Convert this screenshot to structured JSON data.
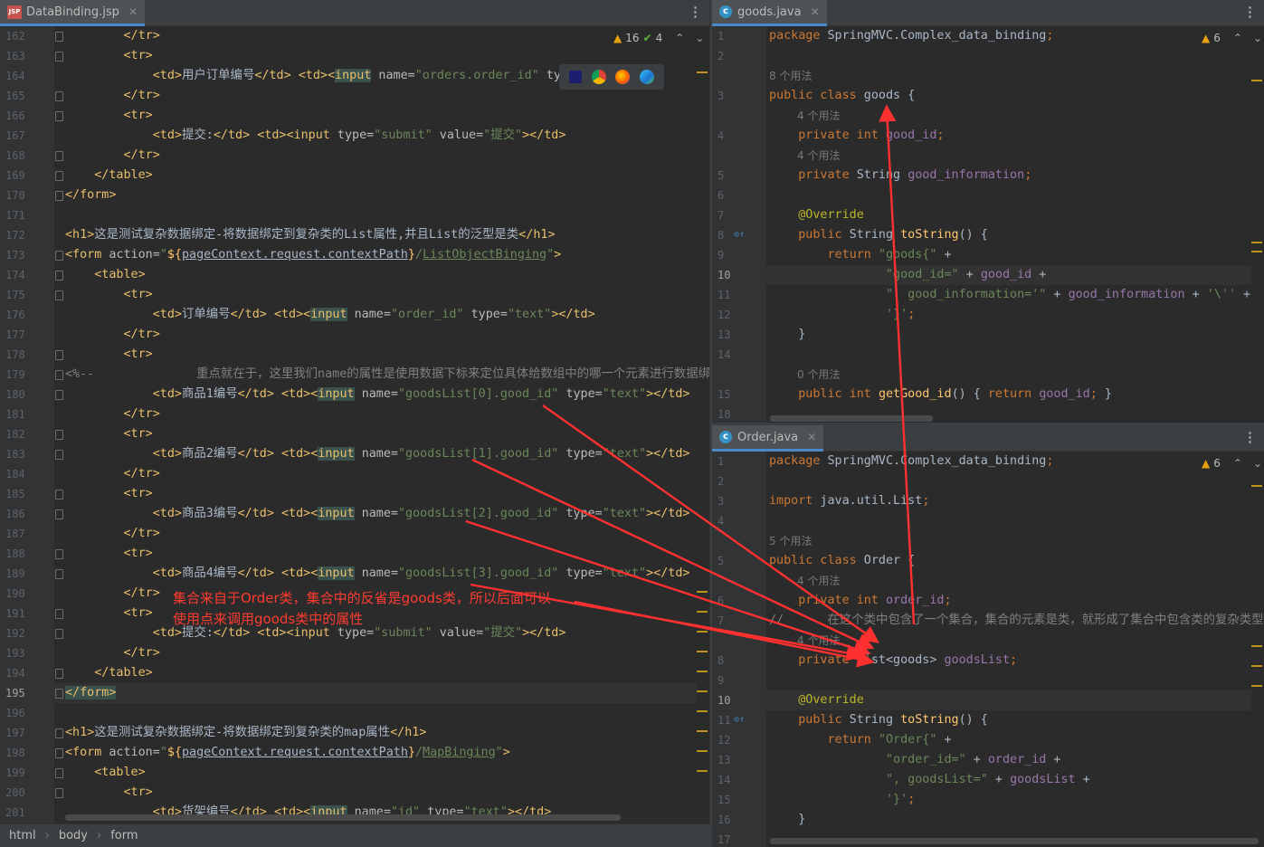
{
  "tabs": {
    "left": {
      "label": "DataBinding.jsp",
      "icon": "jsp-file-icon"
    },
    "right_top": {
      "label": "goods.java",
      "icon": "java-class-icon"
    },
    "right_bottom": {
      "label": "Order.java",
      "icon": "java-class-icon"
    }
  },
  "left_inspections": {
    "warnings": "16",
    "checks": "4"
  },
  "right_top_inspections": {
    "warnings": "6"
  },
  "right_bottom_inspections": {
    "warnings": "6"
  },
  "left_lines": [
    {
      "n": "162",
      "h": "        <span class=tg>&lt;/tr&gt;</span>"
    },
    {
      "n": "163",
      "h": "        <span class=tg>&lt;tr&gt;</span>"
    },
    {
      "n": "164",
      "h": "            <span class=tg>&lt;td&gt;</span>用户订单编号<span class=tg>&lt;/td&gt;</span> <span class=tg>&lt;td&gt;&lt;<span class=hl>input</span></span> <span class=at>name=</span><span class=sv>\"orders.order_id\"</span> <span class=at>typ</span>"
    },
    {
      "n": "165",
      "h": "        <span class=tg>&lt;/tr&gt;</span>"
    },
    {
      "n": "166",
      "h": "        <span class=tg>&lt;tr&gt;</span>"
    },
    {
      "n": "167",
      "h": "            <span class=tg>&lt;td&gt;</span>提交:<span class=tg>&lt;/td&gt;</span> <span class=tg>&lt;td&gt;&lt;input</span> <span class=at>type=</span><span class=sv>\"submit\"</span> <span class=at>value=</span><span class=sv>\"提交\"</span><span class=tg>&gt;&lt;/td&gt;</span>"
    },
    {
      "n": "168",
      "h": "        <span class=tg>&lt;/tr&gt;</span>"
    },
    {
      "n": "169",
      "h": "    <span class=tg>&lt;/table&gt;</span>"
    },
    {
      "n": "170",
      "h": "<span class=tg>&lt;/form&gt;</span>"
    },
    {
      "n": "171",
      "h": ""
    },
    {
      "n": "172",
      "h": "<span class=tg>&lt;h1&gt;</span>这是测试复杂数据绑定-将数据绑定到复杂类的List属性,并且List的泛型是类<span class=tg>&lt;/h1&gt;</span>"
    },
    {
      "n": "173",
      "h": "<span class=tg>&lt;form</span> <span class=at>action=</span><span class=sv>\"</span><span class=mt>${</span><span class=el>pageContext.request.contextPath</span><span class=mt>}</span><span class=sv>/<u>ListObjectBinging</u>\"</span><span class=tg>&gt;</span>"
    },
    {
      "n": "174",
      "h": "    <span class=tg>&lt;table&gt;</span>"
    },
    {
      "n": "175",
      "h": "        <span class=tg>&lt;tr&gt;</span>"
    },
    {
      "n": "176",
      "h": "            <span class=tg>&lt;td&gt;</span>订单编号<span class=tg>&lt;/td&gt;</span> <span class=tg>&lt;td&gt;&lt;<span class=hl>input</span></span> <span class=at>name=</span><span class=sv>\"order_id\"</span> <span class=at>type=</span><span class=sv>\"text\"</span><span class=tg>&gt;&lt;/td&gt;</span>"
    },
    {
      "n": "177",
      "h": "        <span class=tg>&lt;/tr&gt;</span>"
    },
    {
      "n": "178",
      "h": "        <span class=tg>&lt;tr&gt;</span>"
    },
    {
      "n": "179",
      "h": "<span class=cm>&lt;%--              重点就在于，这里我们name的属性是使用数据下标来定位具体给数组中的哪一个元素进行数据绑定--%</span>"
    },
    {
      "n": "180",
      "h": "            <span class=tg>&lt;td&gt;</span>商品1编号<span class=tg>&lt;/td&gt;</span> <span class=tg>&lt;td&gt;&lt;<span class=hl>input</span></span> <span class=at>name=</span><span class=sv>\"goodsList[0].good_id\"</span> <span class=at>type=</span><span class=sv>\"text\"</span><span class=tg>&gt;&lt;/td&gt;</span>"
    },
    {
      "n": "181",
      "h": "        <span class=tg>&lt;/tr&gt;</span>"
    },
    {
      "n": "182",
      "h": "        <span class=tg>&lt;tr&gt;</span>"
    },
    {
      "n": "183",
      "h": "            <span class=tg>&lt;td&gt;</span>商品2编号<span class=tg>&lt;/td&gt;</span> <span class=tg>&lt;td&gt;&lt;<span class=hl>input</span></span> <span class=at>name=</span><span class=sv>\"goodsList[1].good_id\"</span> <span class=at>type=</span><span class=sv>\"text\"</span><span class=tg>&gt;&lt;/td&gt;</span>"
    },
    {
      "n": "184",
      "h": "        <span class=tg>&lt;/tr&gt;</span>"
    },
    {
      "n": "185",
      "h": "        <span class=tg>&lt;tr&gt;</span>"
    },
    {
      "n": "186",
      "h": "            <span class=tg>&lt;td&gt;</span>商品3编号<span class=tg>&lt;/td&gt;</span> <span class=tg>&lt;td&gt;&lt;<span class=hl>input</span></span> <span class=at>name=</span><span class=sv>\"goodsList[2].good_id\"</span> <span class=at>type=</span><span class=sv>\"text\"</span><span class=tg>&gt;&lt;/td&gt;</span>"
    },
    {
      "n": "187",
      "h": "        <span class=tg>&lt;/tr&gt;</span>"
    },
    {
      "n": "188",
      "h": "        <span class=tg>&lt;tr&gt;</span>"
    },
    {
      "n": "189",
      "h": "            <span class=tg>&lt;td&gt;</span>商品4编号<span class=tg>&lt;/td&gt;</span> <span class=tg>&lt;td&gt;&lt;<span class=hl>input</span></span> <span class=at>name=</span><span class=sv>\"goodsList[3].good_id\"</span> <span class=at>type=</span><span class=sv>\"text\"</span><span class=tg>&gt;&lt;/td&gt;</span>"
    },
    {
      "n": "190",
      "h": "        <span class=tg>&lt;/tr&gt;</span>"
    },
    {
      "n": "191",
      "h": "        <span class=tg>&lt;tr&gt;</span>"
    },
    {
      "n": "192",
      "h": "            <span class=tg>&lt;td&gt;</span>提交:<span class=tg>&lt;/td&gt;</span> <span class=tg>&lt;td&gt;&lt;input</span> <span class=at>type=</span><span class=sv>\"submit\"</span> <span class=at>value=</span><span class=sv>\"提交\"</span><span class=tg>&gt;&lt;/td&gt;</span>"
    },
    {
      "n": "193",
      "h": "        <span class=tg>&lt;/tr&gt;</span>"
    },
    {
      "n": "194",
      "h": "    <span class=tg>&lt;/table&gt;</span>"
    },
    {
      "n": "195",
      "h": "<span class=tg style='background:#3b514d'>&lt;/form&gt;</span>"
    },
    {
      "n": "196",
      "h": ""
    },
    {
      "n": "197",
      "h": "<span class=tg>&lt;h1&gt;</span>这是测试复杂数据绑定-将数据绑定到复杂类的map属性<span class=tg>&lt;/h1&gt;</span>"
    },
    {
      "n": "198",
      "h": "<span class=tg>&lt;form</span> <span class=at>action=</span><span class=sv>\"</span><span class=mt>${</span><span class=el>pageContext.request.contextPath</span><span class=mt>}</span><span class=sv>/<u>MapBinging</u>\"</span><span class=tg>&gt;</span>"
    },
    {
      "n": "199",
      "h": "    <span class=tg>&lt;table&gt;</span>"
    },
    {
      "n": "200",
      "h": "        <span class=tg>&lt;tr&gt;</span>"
    },
    {
      "n": "201",
      "h": "            <span class=tg>&lt;td&gt;</span>货架编号<span class=tg>&lt;/td&gt;</span> <span class=tg>&lt;td&gt;&lt;<span class=hl>input</span></span> <span class=at>name=</span><span class=sv>\"id\"</span> <span class=at>type=</span><span class=sv>\"text\"</span><span class=tg>&gt;&lt;/td&gt;</span>"
    }
  ],
  "left_current_line": "195",
  "goods_lines": [
    {
      "n": "1",
      "h": "<span class=kw>package</span> SpringMVC.Complex_data_binding<span class=kw>;</span>"
    },
    {
      "n": "2",
      "h": ""
    },
    {
      "n": "3",
      "h": "<span class=kw>public class</span> goods {",
      "hint": "8 个用法"
    },
    {
      "n": "4",
      "h": "    <span class=kw>private int</span> <span class=fd>good_id</span><span class=kw>;</span>",
      "hint": "4 个用法"
    },
    {
      "n": "5",
      "h": "    <span class=kw>private</span> String <span class=fd>good_information</span><span class=kw>;</span>",
      "hint": "4 个用法"
    },
    {
      "n": "6",
      "h": ""
    },
    {
      "n": "7",
      "h": "    <span class=an>@Override</span>"
    },
    {
      "n": "8",
      "h": "    <span class=kw>public</span> String <span class=mt>toString</span>() {"
    },
    {
      "n": "9",
      "h": "        <span class=kw>return</span> <span class=sv>\"goods{\"</span> +"
    },
    {
      "n": "10",
      "h": "                <span class=sv>\"good_id=\"</span> + <span class=fd>good_id</span> +"
    },
    {
      "n": "11",
      "h": "                <span class=sv>\", good_information='\"</span> + <span class=fd>good_information</span> + <span class=sv>'\\''</span> +"
    },
    {
      "n": "12",
      "h": "                <span class=sv>'}'</span><span class=kw>;</span>"
    },
    {
      "n": "13",
      "h": "    }"
    },
    {
      "n": "14",
      "h": ""
    },
    {
      "n": "15",
      "h": "    <span class=kw>public int</span> <span class=mt>getGood_id</span>() { <span class=kw>return</span> <span class=fd>good_id</span><span class=kw>;</span> }",
      "hint": "0 个用法"
    },
    {
      "n": "18",
      "h": ""
    }
  ],
  "order_lines": [
    {
      "n": "1",
      "h": "<span class=kw>package</span> SpringMVC.Complex_data_binding<span class=kw>;</span>"
    },
    {
      "n": "2",
      "h": ""
    },
    {
      "n": "3",
      "h": "<span class=kw>import</span> java.util.List<span class=kw>;</span>"
    },
    {
      "n": "4",
      "h": ""
    },
    {
      "n": "5",
      "h": "<span class=kw>public class</span> Order {",
      "hint": "5 个用法"
    },
    {
      "n": "6",
      "h": "    <span class=kw>private int</span> <span class=fd>order_id</span><span class=kw>;</span>",
      "hint": "4 个用法"
    },
    {
      "n": "7",
      "h": "<span class=cm>//      在这个类中包含了一个集合，集合的元素是类，就形成了集合中包含类的复杂类型</span>"
    },
    {
      "n": "8",
      "h": "    <span class=kw>private</span> List&lt;goods&gt; <span class=fd>goodsList</span><span class=kw>;</span>",
      "hint": "4 个用法"
    },
    {
      "n": "9",
      "h": ""
    },
    {
      "n": "10",
      "h": "    <span class=an>@Override</span>"
    },
    {
      "n": "11",
      "h": "    <span class=kw>public</span> String <span class=mt>toString</span>() {"
    },
    {
      "n": "12",
      "h": "        <span class=kw>return</span> <span class=sv>\"Order{\"</span> +"
    },
    {
      "n": "13",
      "h": "                <span class=sv>\"order_id=\"</span> + <span class=fd>order_id</span> +"
    },
    {
      "n": "14",
      "h": "                <span class=sv>\", goodsList=\"</span> + <span class=fd>goodsList</span> +"
    },
    {
      "n": "15",
      "h": "                <span class=sv>'}'</span><span class=kw>;</span>"
    },
    {
      "n": "16",
      "h": "    }"
    },
    {
      "n": "17",
      "h": ""
    }
  ],
  "annotation": {
    "line1": "集合来自于Order类，集合中的反省是goods类，所以后面可以",
    "line2": "使用点来调用goods类中的属性"
  },
  "breadcrumb": [
    "html",
    "body",
    "form"
  ],
  "colors": {
    "annotation": "#ff3b30",
    "arrow": "#ff3030",
    "tab_underline": "#4a88c7"
  }
}
